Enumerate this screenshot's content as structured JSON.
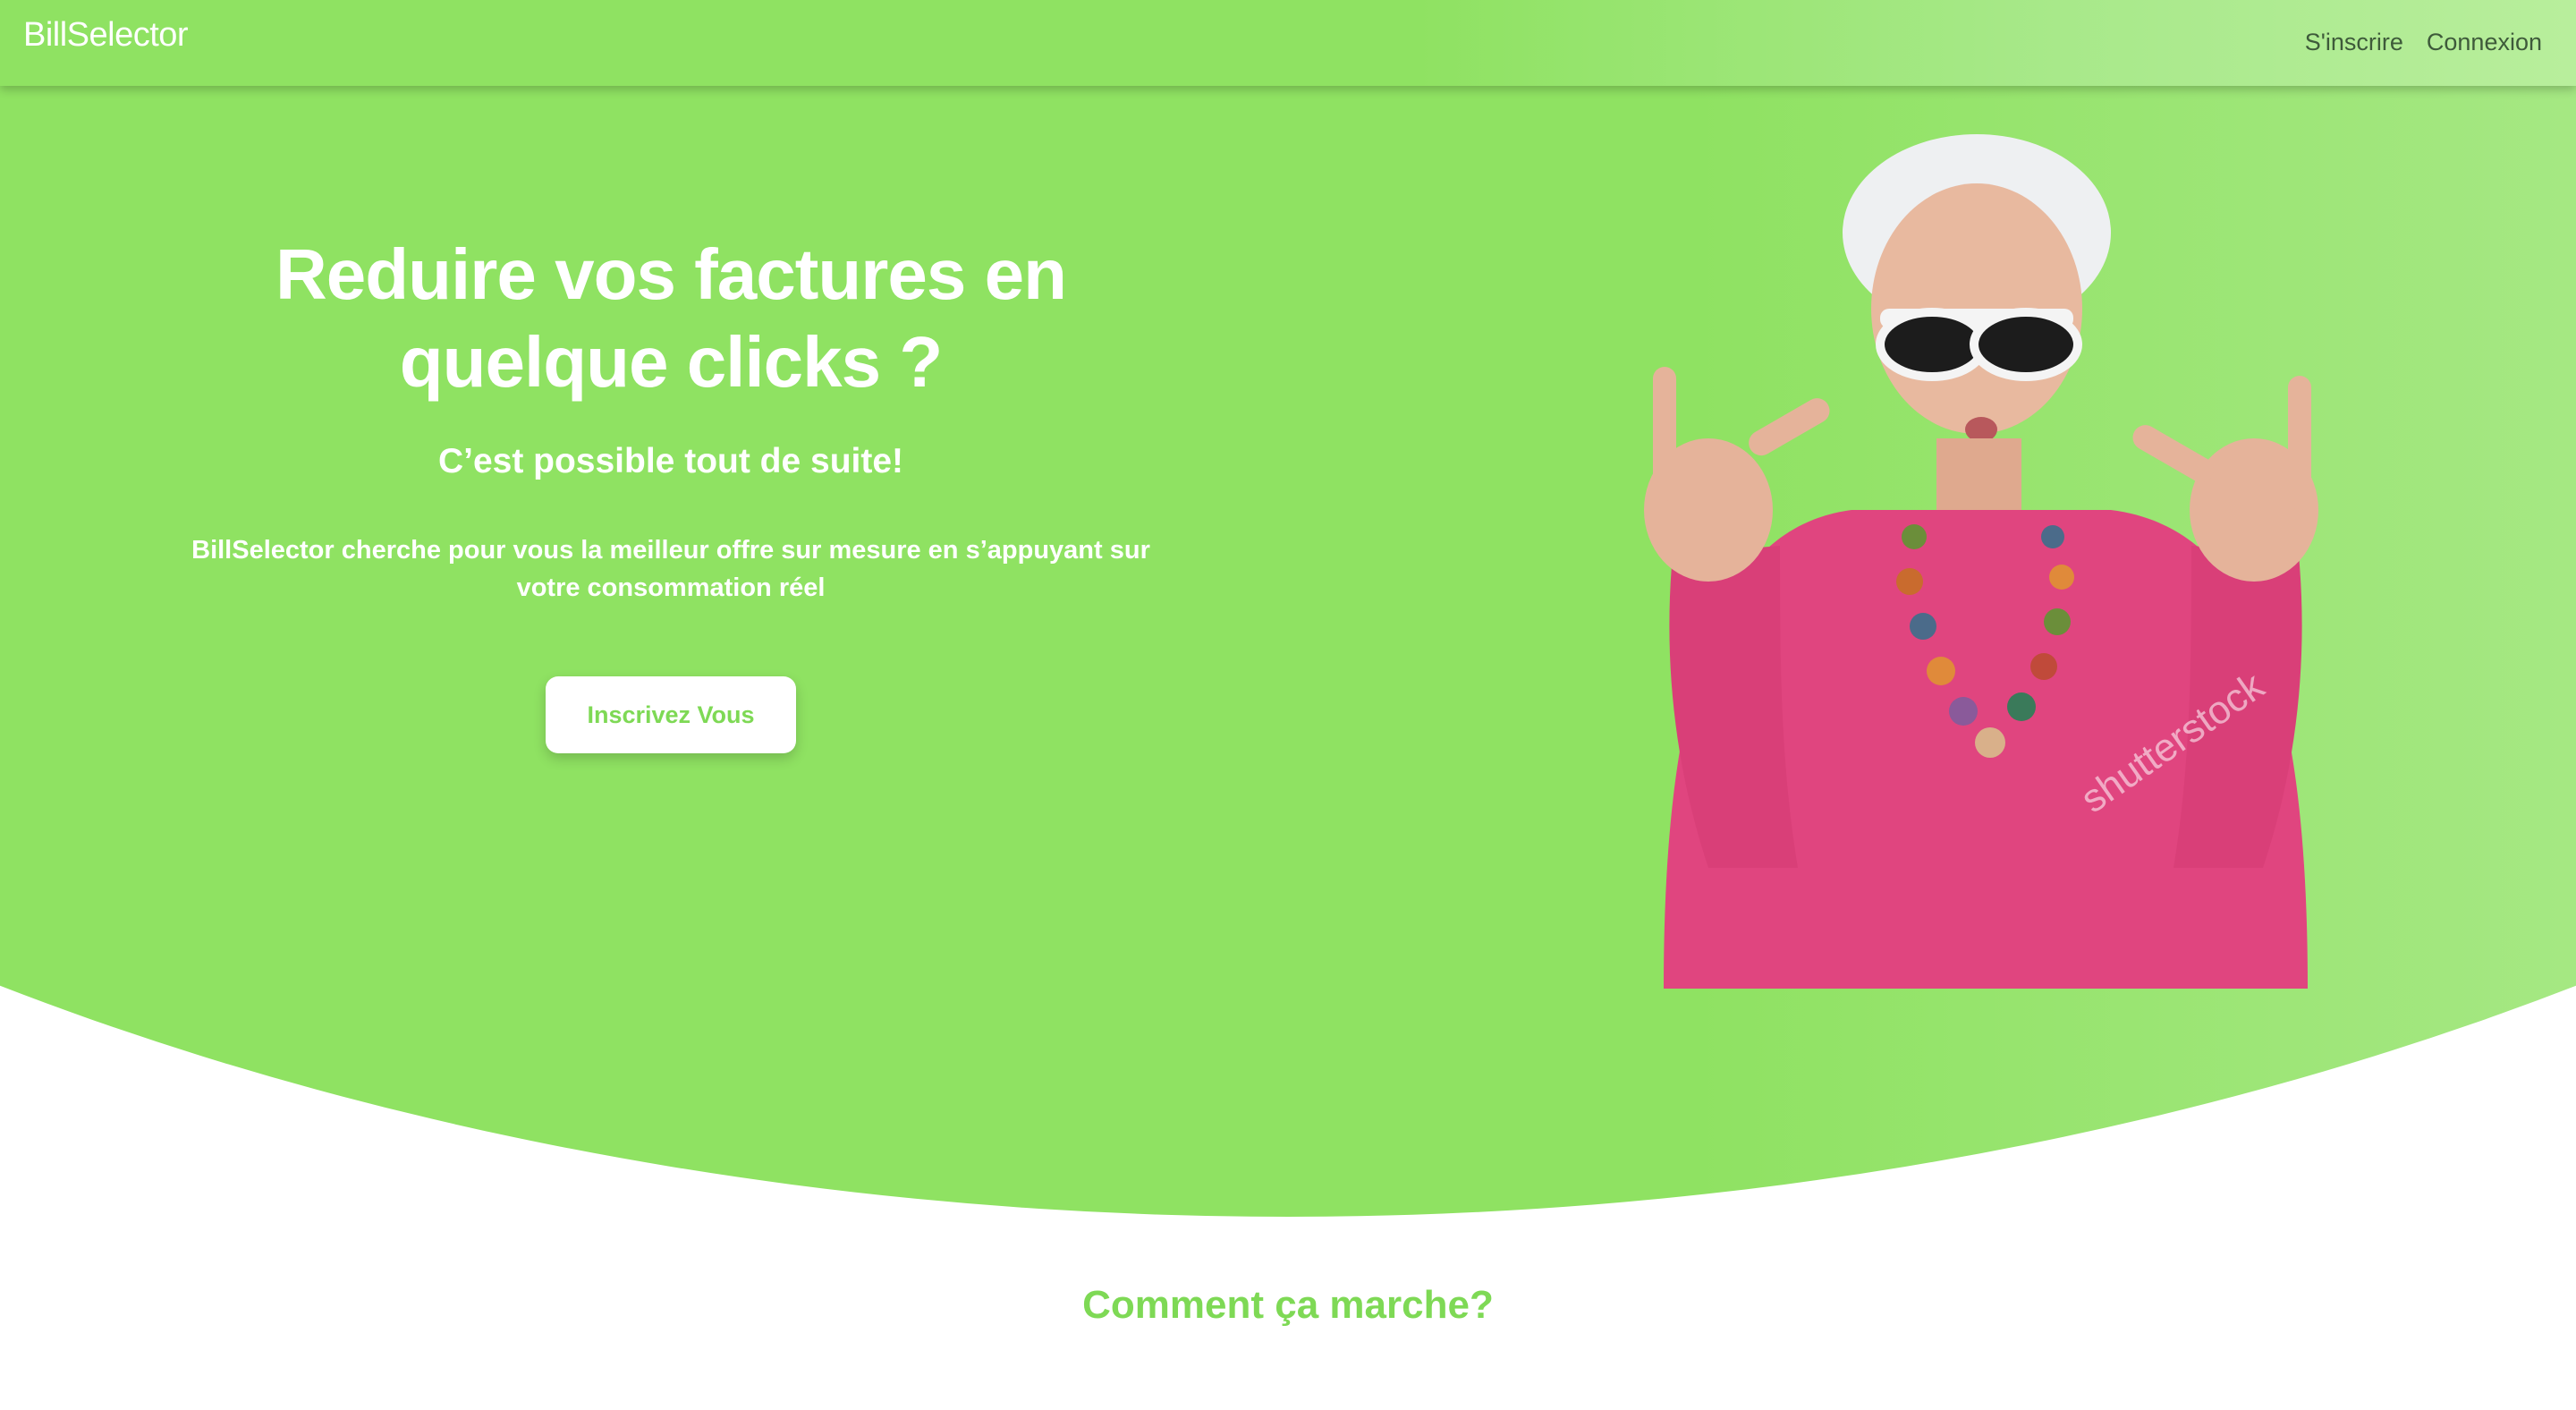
{
  "navbar": {
    "brand": "BillSelector",
    "links": [
      "S'inscrire",
      "Connexion"
    ]
  },
  "hero": {
    "title_line1": "Reduire vos factures en",
    "title_line2": "quelque clicks ?",
    "subtitle": "C’est possible tout de suite!",
    "description": "BillSelector cherche pour vous la meilleur offre sur mesure en s’appuyant sur votre consommation réel",
    "cta_label": "Inscrivez Vous",
    "image_watermark": "shutterstock"
  },
  "how_it_works": {
    "title": "Comment ça marche?"
  },
  "colors": {
    "brand_green": "#8fe262",
    "accent_green": "#7ed955",
    "nav_link": "#3e5a3a",
    "blouse_pink": "#e0457f"
  }
}
